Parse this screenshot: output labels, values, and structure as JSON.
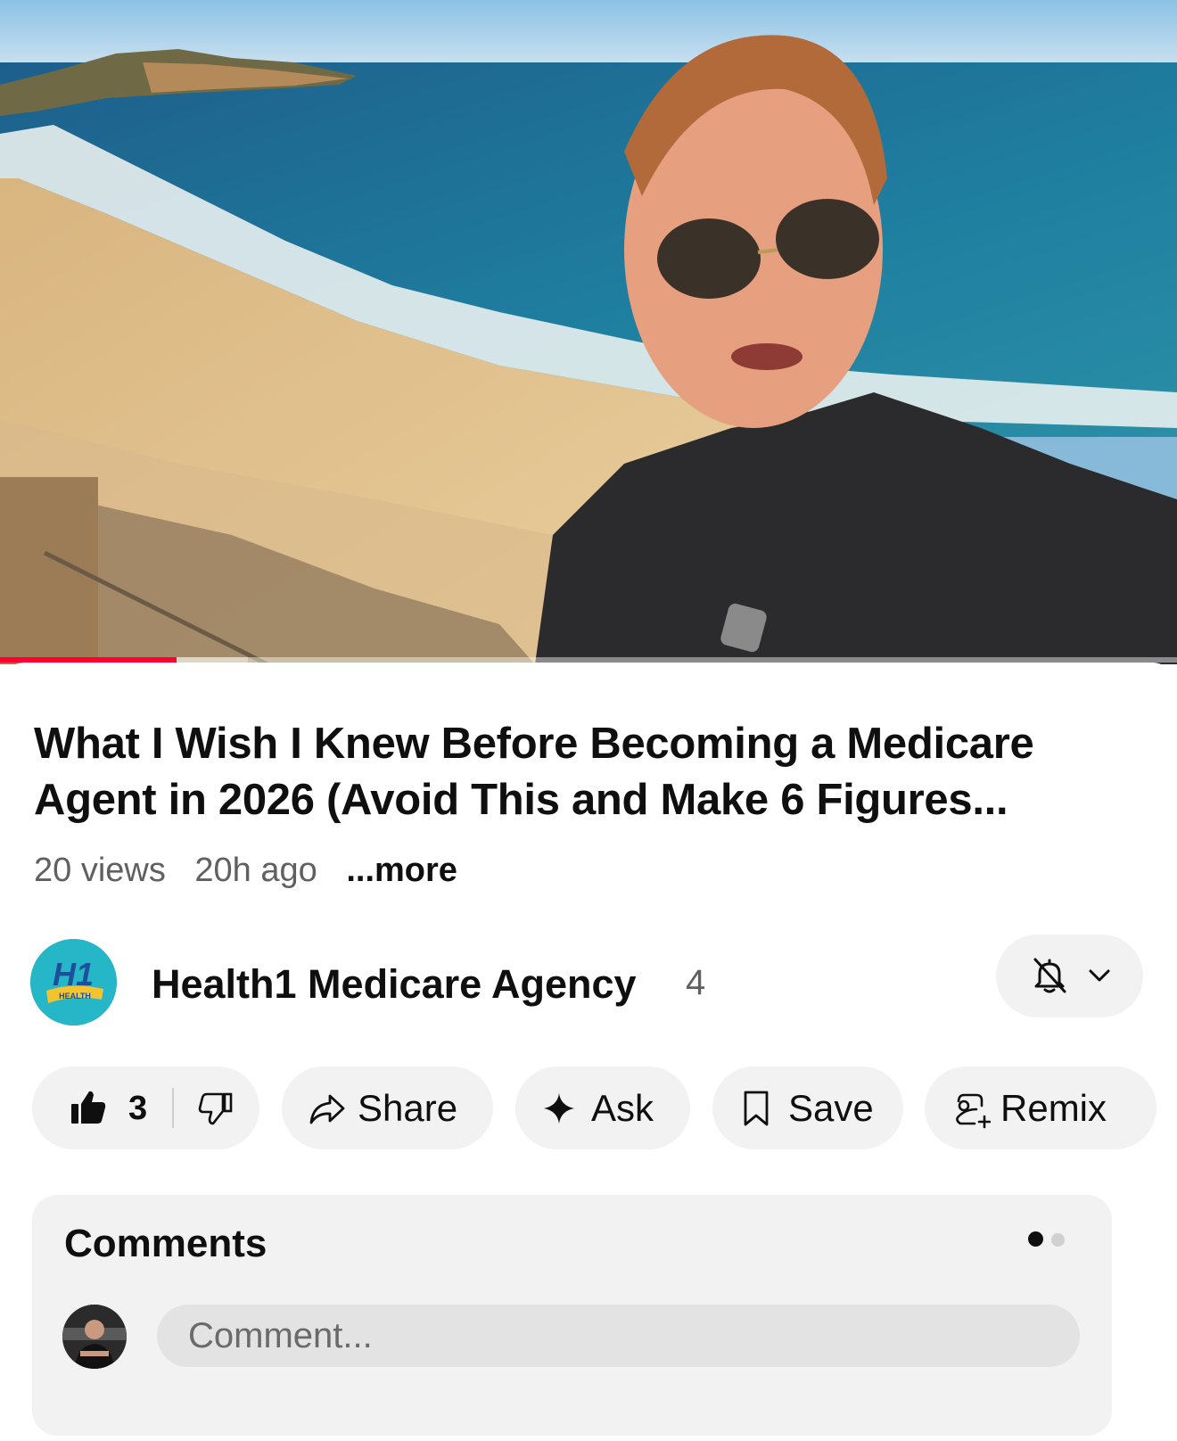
{
  "video": {
    "progress_fraction": 0.15,
    "accent_color": "#ff0033"
  },
  "title": "What I Wish I Knew Before Becoming a Medicare Agent in 2026 (Avoid This and Make 6 Figures...",
  "meta": {
    "views": "20 views",
    "age": "20h ago",
    "more": "...more"
  },
  "channel": {
    "name": "Health1 Medicare Agency",
    "subscribers": "4",
    "logo_text": "H1",
    "logo_subtext": "HEALTH",
    "notification_icon": "bell-off-icon"
  },
  "actions": {
    "likes": "3",
    "share": "Share",
    "ask": "Ask",
    "save": "Save",
    "remix": "Remix"
  },
  "comments": {
    "title": "Comments",
    "placeholder": "Comment...",
    "page_indicator": {
      "count": 2,
      "active": 0
    }
  }
}
